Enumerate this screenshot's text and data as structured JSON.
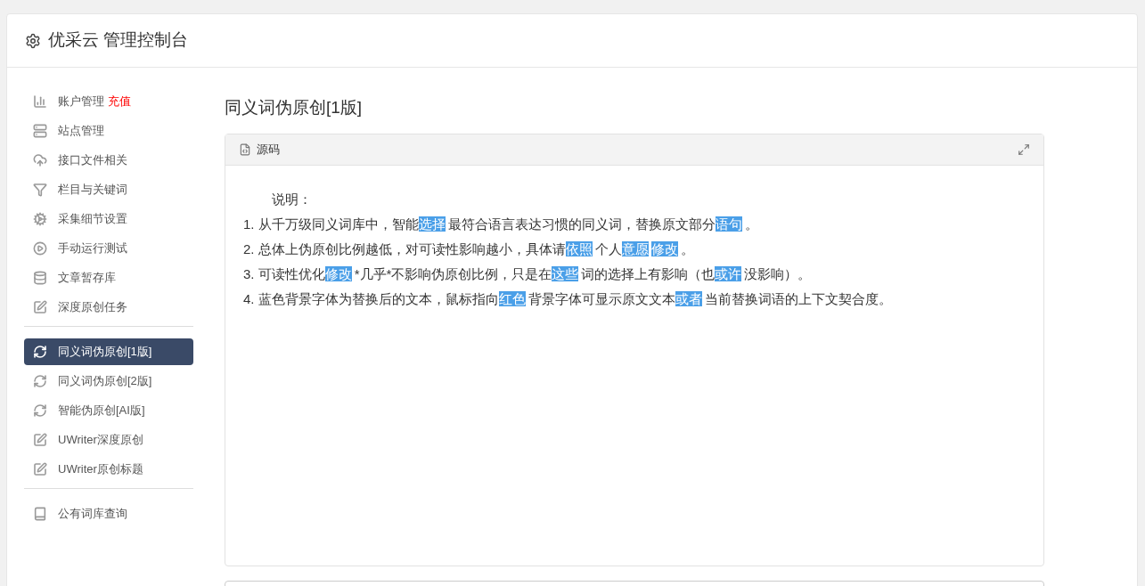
{
  "header": {
    "title": "优采云 管理控制台"
  },
  "sidebar": {
    "groups": [
      {
        "items": [
          {
            "label": "账户管理",
            "badge": "充值",
            "selected": false
          },
          {
            "label": "站点管理",
            "selected": false
          },
          {
            "label": "接口文件相关",
            "selected": false
          },
          {
            "label": "栏目与关键词",
            "selected": false
          },
          {
            "label": "采集细节设置",
            "selected": false
          },
          {
            "label": "手动运行测试",
            "selected": false
          },
          {
            "label": "文章暂存库",
            "selected": false
          },
          {
            "label": "深度原创任务",
            "selected": false
          }
        ]
      },
      {
        "items": [
          {
            "label": "同义词伪原创[1版]",
            "selected": true
          },
          {
            "label": "同义词伪原创[2版]",
            "selected": false
          },
          {
            "label": "智能伪原创[AI版]",
            "selected": false
          },
          {
            "label": "UWriter深度原创",
            "selected": false
          },
          {
            "label": "UWriter原创标题",
            "selected": false
          }
        ]
      },
      {
        "items": [
          {
            "label": "公有词库查询",
            "selected": false
          }
        ]
      }
    ]
  },
  "main": {
    "title": "同义词伪原创[1版]",
    "editor": {
      "tab": "源码",
      "heading": "说明：",
      "lines": [
        [
          {
            "text": "1. 从千万级同义词库中，智能",
            "highlighted": false
          },
          {
            "text": "选择",
            "highlighted": true
          },
          {
            "text": "最符合语言表达习惯的同义词，替换原文部分",
            "highlighted": false
          },
          {
            "text": "语句",
            "highlighted": true
          },
          {
            "text": "。",
            "highlighted": false
          }
        ],
        [
          {
            "text": "2. 总体上伪原创比例越低，对可读性影响越小，具体请",
            "highlighted": false
          },
          {
            "text": "依照",
            "highlighted": true
          },
          {
            "text": "个人",
            "highlighted": false
          },
          {
            "text": "意愿",
            "highlighted": true
          },
          {
            "text": "修改",
            "highlighted": true
          },
          {
            "text": "。",
            "highlighted": false
          }
        ],
        [
          {
            "text": "3. 可读性优化",
            "highlighted": false
          },
          {
            "text": "修改",
            "highlighted": true
          },
          {
            "text": "*几乎*不影响伪原创比例，只是在",
            "highlighted": false
          },
          {
            "text": "这些",
            "highlighted": true
          },
          {
            "text": "词的选择上有影响（也",
            "highlighted": false
          },
          {
            "text": "或许",
            "highlighted": true
          },
          {
            "text": "没影响）。",
            "highlighted": false
          }
        ],
        [
          {
            "text": "4. 蓝色背景字体为替换后的文本，鼠标指向",
            "highlighted": false
          },
          {
            "text": "红色",
            "highlighted": true
          },
          {
            "text": "背景字体可显示原文文本",
            "highlighted": false
          },
          {
            "text": "或者",
            "highlighted": true
          },
          {
            "text": "当前替换词语的上下文契合度。",
            "highlighted": false
          }
        ]
      ]
    }
  }
}
